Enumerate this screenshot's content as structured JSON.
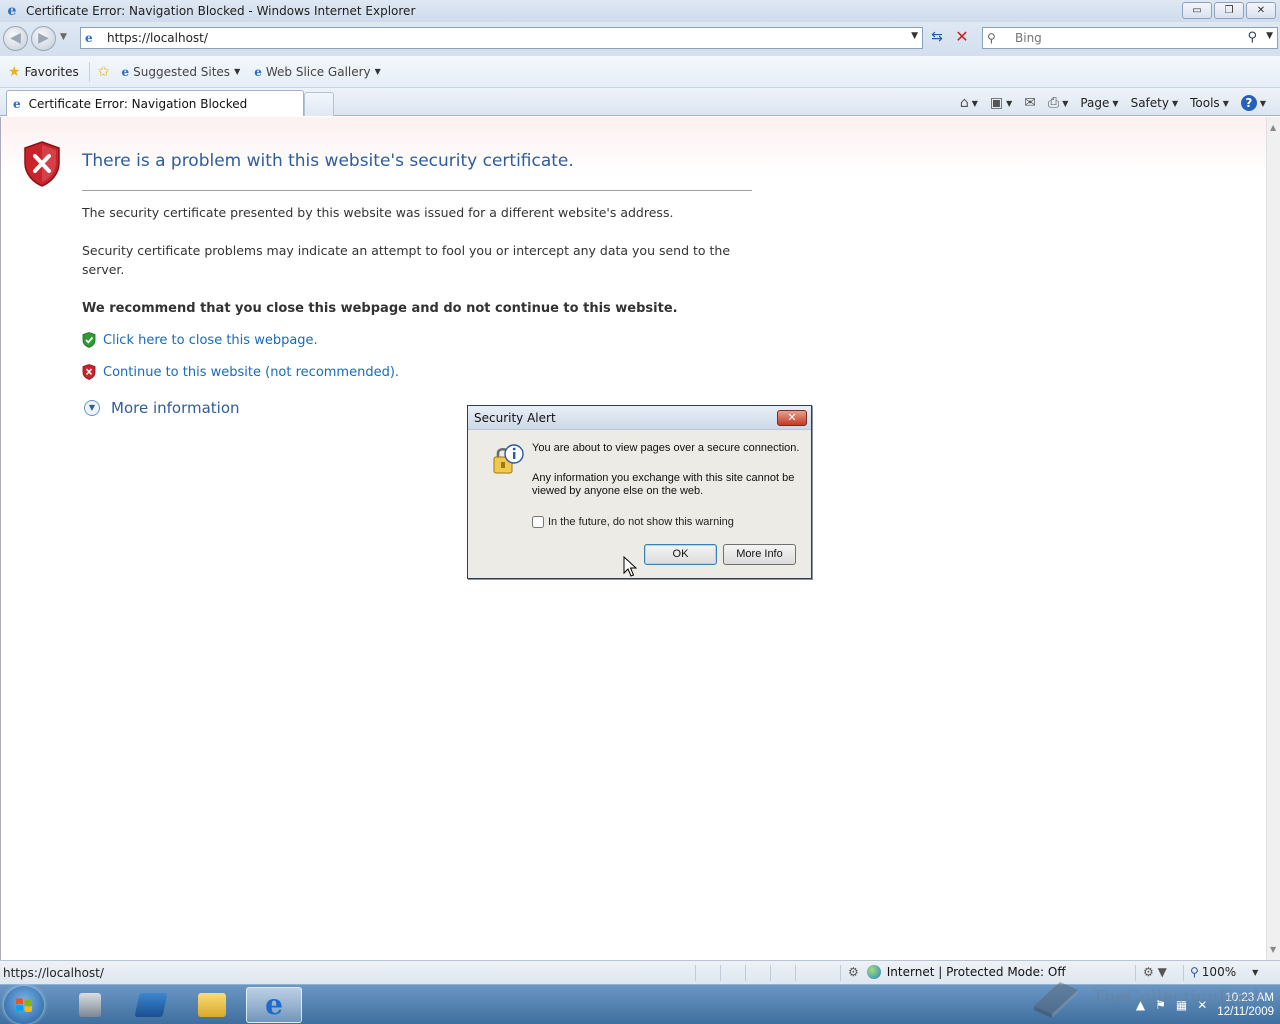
{
  "window": {
    "title": "Certificate Error: Navigation Blocked - Windows Internet Explorer",
    "buttons": {
      "minimize": "▭",
      "restore": "❐",
      "close": "✕"
    }
  },
  "navigation": {
    "url": "https://localhost/",
    "search_placeholder": "Bing"
  },
  "favorites_bar": {
    "favorites_label": "Favorites",
    "items": [
      {
        "label": "Suggested Sites"
      },
      {
        "label": "Web Slice Gallery"
      }
    ]
  },
  "tabs": {
    "active_label": "Certificate Error: Navigation Blocked"
  },
  "command_bar": {
    "page_label": "Page",
    "safety_label": "Safety",
    "tools_label": "Tools",
    "help_glyph": "?"
  },
  "error_page": {
    "title": "There is a problem with this website's security certificate.",
    "paragraph1": "The security certificate presented by this website was issued for a different website's address.",
    "paragraph2": "Security certificate problems may indicate an attempt to fool you or intercept any data you send to the server.",
    "recommendation": "We recommend that you close this webpage and do not continue to this website.",
    "close_link": "Click here to close this webpage.",
    "continue_link": "Continue to this website (not recommended).",
    "more_info": "More information"
  },
  "dialog": {
    "title": "Security Alert",
    "close_glyph": "✕",
    "text1": "You are about to view pages over a secure connection.",
    "text2": "Any information you exchange with this site cannot be viewed by anyone else on the web.",
    "checkbox_label": "In the future, do not show this warning",
    "checkbox_checked": false,
    "ok_label": "OK",
    "more_info_label": "More Info"
  },
  "status_bar": {
    "url": "https://localhost/",
    "zone": "Internet | Protected Mode: Off",
    "zoom": "100%"
  },
  "taskbar": {
    "clock_time": "10:23 AM",
    "clock_date": "12/11/2009",
    "watermark": "TheCollectionBook"
  },
  "colors": {
    "link": "#1a6ab8",
    "title_blue": "#2f5d9a",
    "error_red": "#c8242a",
    "safe_green": "#2f9a34"
  },
  "icons": {
    "app": "ie-icon",
    "error": "red-shield-x-icon",
    "close_ok": "green-shield-check-icon",
    "continue_bad": "red-shield-x-icon",
    "expand": "chevron-down-circle-icon",
    "dialog": "lock-info-icon"
  }
}
